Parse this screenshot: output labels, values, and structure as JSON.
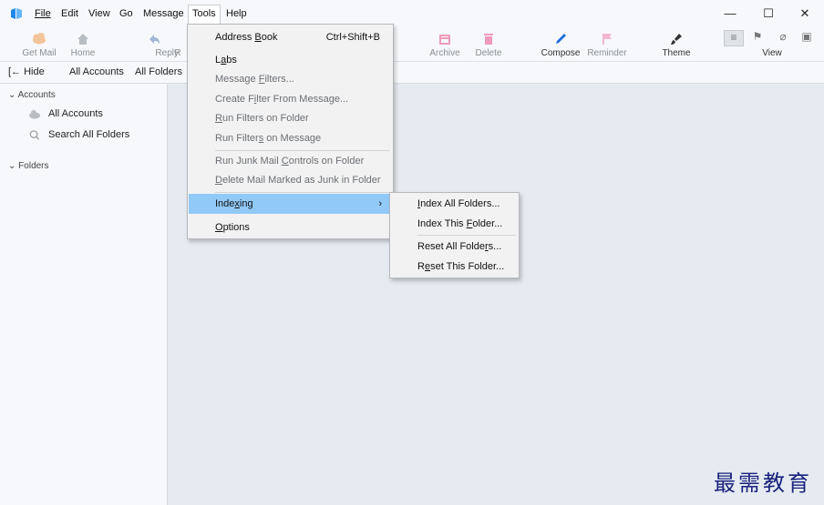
{
  "menubar": {
    "items": [
      {
        "id": "file",
        "label": "File"
      },
      {
        "id": "edit",
        "label": "Edit"
      },
      {
        "id": "view",
        "label": "View"
      },
      {
        "id": "go",
        "label": "Go"
      },
      {
        "id": "message",
        "label": "Message"
      },
      {
        "id": "tools",
        "label": "Tools"
      },
      {
        "id": "help",
        "label": "Help"
      }
    ],
    "window_controls": {
      "minimize": "—",
      "maximize": "☐",
      "close": "✕"
    }
  },
  "toolbar": {
    "buttons": [
      {
        "id": "get-mail",
        "label": "Get Mail",
        "icon": "cloud-download-icon"
      },
      {
        "id": "home",
        "label": "Home",
        "icon": "home-icon"
      },
      {
        "id": "reply",
        "label": "Reply",
        "icon": "reply-icon"
      },
      {
        "id": "reply-all-partial",
        "label": "R",
        "icon": ""
      },
      {
        "id": "archive",
        "label": "Archive",
        "icon": "archive-icon"
      },
      {
        "id": "delete",
        "label": "Delete",
        "icon": "trash-icon"
      },
      {
        "id": "compose",
        "label": "Compose",
        "icon": "pencil-icon"
      },
      {
        "id": "reminder",
        "label": "Reminder",
        "icon": "flag-icon"
      },
      {
        "id": "theme",
        "label": "Theme",
        "icon": "paintbrush-icon"
      }
    ],
    "view_label": "View",
    "colors": {
      "disabled_label": "#8a8f96",
      "compose": "#1e6fd9",
      "archive": "#e8629b",
      "delete": "#e8629b",
      "reminder": "#f5b7cf"
    }
  },
  "folderbar": {
    "hide_label": "[← Hide",
    "all_accounts": "All Accounts",
    "all_folders": "All Folders"
  },
  "sidebar": {
    "accounts_header": "Accounts",
    "all_accounts": "All Accounts",
    "search_all_folders": "Search All Folders",
    "folders_header": "Folders"
  },
  "tools_menu": {
    "address_book": {
      "pre": "Address ",
      "acc": "B",
      "post": "ook",
      "shortcut": "Ctrl+Shift+B"
    },
    "labs": {
      "pre": "L",
      "acc": "a",
      "post": "bs"
    },
    "message_filters": {
      "pre": "Message ",
      "acc": "F",
      "post": "ilters..."
    },
    "create_filter": {
      "pre": "Create F",
      "acc": "i",
      "post": "lter From Message..."
    },
    "run_filters_folder": {
      "pre": "",
      "acc": "R",
      "post": "un Filters on Folder"
    },
    "run_filters_message": {
      "pre": "Run Filter",
      "acc": "s",
      "post": " on Message"
    },
    "run_junk": {
      "pre": "Run Junk Mail ",
      "acc": "C",
      "post": "ontrols on Folder"
    },
    "delete_junk": {
      "pre": "",
      "acc": "D",
      "post": "elete Mail Marked as Junk in Folder"
    },
    "indexing": {
      "pre": "Inde",
      "acc": "x",
      "post": "ing",
      "arrow": "›"
    },
    "options": {
      "pre": "",
      "acc": "O",
      "post": "ptions"
    }
  },
  "indexing_menu": {
    "index_all": {
      "pre": "",
      "acc": "I",
      "post": "ndex All Folders..."
    },
    "index_this": {
      "pre": "Index This ",
      "acc": "F",
      "post": "older..."
    },
    "reset_all": {
      "pre": "Reset All Folde",
      "acc": "r",
      "post": "s..."
    },
    "reset_this": {
      "pre": "R",
      "acc": "e",
      "post": "set This Folder..."
    }
  },
  "watermark": "最需教育"
}
